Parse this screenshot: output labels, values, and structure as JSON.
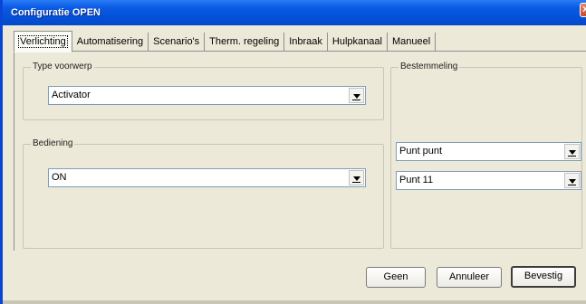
{
  "window": {
    "title": "Configuratie OPEN"
  },
  "tabs": [
    {
      "label": "Verlichting",
      "active": true
    },
    {
      "label": "Automatisering",
      "active": false
    },
    {
      "label": "Scenario's",
      "active": false
    },
    {
      "label": "Therm. regeling",
      "active": false
    },
    {
      "label": "Inbraak",
      "active": false
    },
    {
      "label": "Hulpkanaal",
      "active": false
    },
    {
      "label": "Manueel",
      "active": false
    }
  ],
  "groups": {
    "type": {
      "label": "Type voorwerp",
      "value": "Activator"
    },
    "bediening": {
      "label": "Bediening",
      "value": "ON"
    },
    "bestemmeling": {
      "label": "Bestemmeling",
      "value1": "Punt punt",
      "value2": "Punt 11"
    }
  },
  "buttons": {
    "geen": "Geen",
    "annuleer": "Annuleer",
    "bevestig": "Bevestig"
  },
  "colors": {
    "titlebar": "#0450d8",
    "face": "#ece9d8",
    "combo_border": "#7f9db9"
  }
}
